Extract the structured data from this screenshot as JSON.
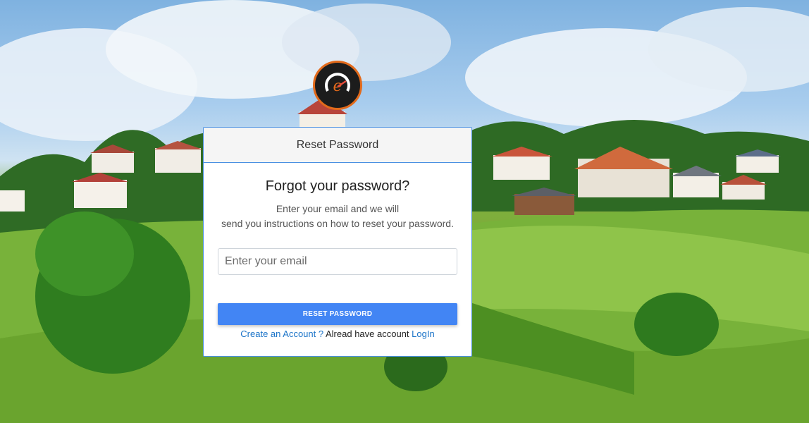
{
  "card": {
    "header_title": "Reset Password",
    "heading": "Forgot your password?",
    "description_line1": "Enter your email and we will",
    "description_line2": "send you instructions on how to reset your password."
  },
  "email": {
    "placeholder": "Enter your email",
    "value": ""
  },
  "submit_label": "RESET PASSWORD",
  "footer": {
    "create_account": "Create an Account ?",
    "already_text": "Alread have account",
    "login": "LogIn"
  },
  "colors": {
    "accent": "#4285f4",
    "border": "#4a90e2",
    "link": "#1a73c8",
    "logo_ring": "#e26a1b"
  },
  "icons": {
    "logo": "brand-logo-icon"
  }
}
